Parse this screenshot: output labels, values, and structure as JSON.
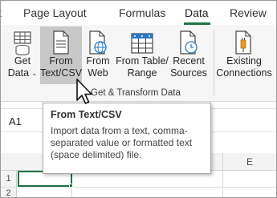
{
  "ribbon_tabs": [
    {
      "label": "Page Layout"
    },
    {
      "label": "Formulas"
    },
    {
      "label": "Data",
      "active": true
    },
    {
      "label": "Review"
    }
  ],
  "ribbon_group": {
    "label": "Get & Transform Data",
    "buttons": [
      {
        "line1": "Get",
        "line2": "Data",
        "caret": "⌄",
        "icon": "database-table-icon"
      },
      {
        "line1": "From",
        "line2": "Text/CSV",
        "icon": "text-file-icon",
        "hovered": true
      },
      {
        "line1": "From",
        "line2": "Web",
        "icon": "web-page-icon"
      },
      {
        "line1": "From Table/",
        "line2": "Range",
        "icon": "table-range-icon"
      },
      {
        "line1": "Recent",
        "line2": "Sources",
        "icon": "clock-file-icon"
      },
      {
        "line1": "Existing",
        "line2": "Connections",
        "icon": "connections-file-icon"
      }
    ]
  },
  "name_box": "A1",
  "grid": {
    "column_label": "E",
    "row_labels": [
      "1",
      "2"
    ]
  },
  "tooltip": {
    "title": "From Text/CSV",
    "body": "Import data from a text, comma-separated value or formatted text (space delimited) file."
  },
  "colors": {
    "accent": "#217346",
    "hover_bg": "#c8c8c8",
    "ribbon_bg": "#f6f6f6"
  }
}
